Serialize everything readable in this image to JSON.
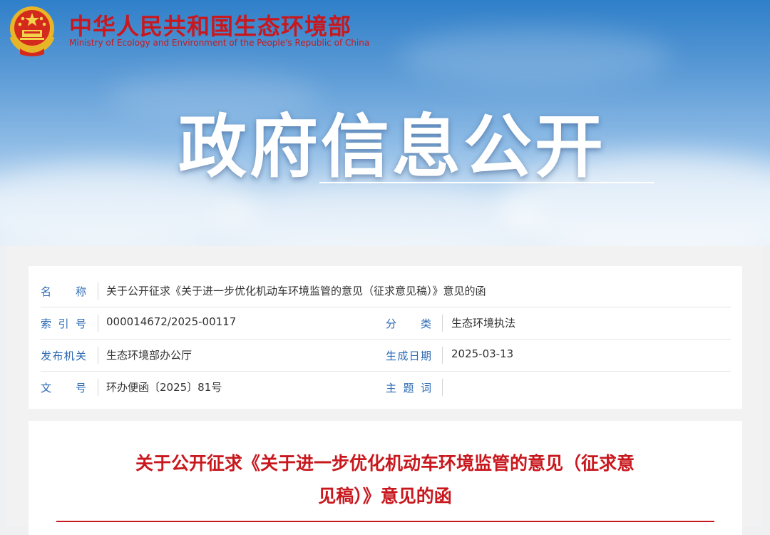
{
  "header": {
    "site_title": "中华人民共和国生态环境部",
    "site_subtitle": "Ministry of Ecology and Environment of the People's Republic of China",
    "hero_title": "政府信息公开"
  },
  "info": {
    "name_label": "名　　称",
    "name_value": "关于公开征求《关于进一步优化机动车环境监管的意见（征求意见稿）》意见的函",
    "index_label": "索 引 号",
    "index_value": "000014672/2025-00117",
    "category_label": "分　　类",
    "category_value": "生态环境执法",
    "issuer_label": "发布机关",
    "issuer_value": "生态环境部办公厅",
    "date_label": "生成日期",
    "date_value": "2025-03-13",
    "docno_label": "文　　号",
    "docno_value": "环办便函〔2025〕81号",
    "keywords_label": "主 题 词",
    "keywords_value": ""
  },
  "document": {
    "title_line1": "关于公开征求《关于进一步优化机动车环境监管的意见（征求意",
    "title_line2": "见稿）》意见的函"
  },
  "colors": {
    "brand_red": "#c8181e",
    "label_blue": "#2a69b4",
    "sky_blue": "#5c9bd6"
  }
}
